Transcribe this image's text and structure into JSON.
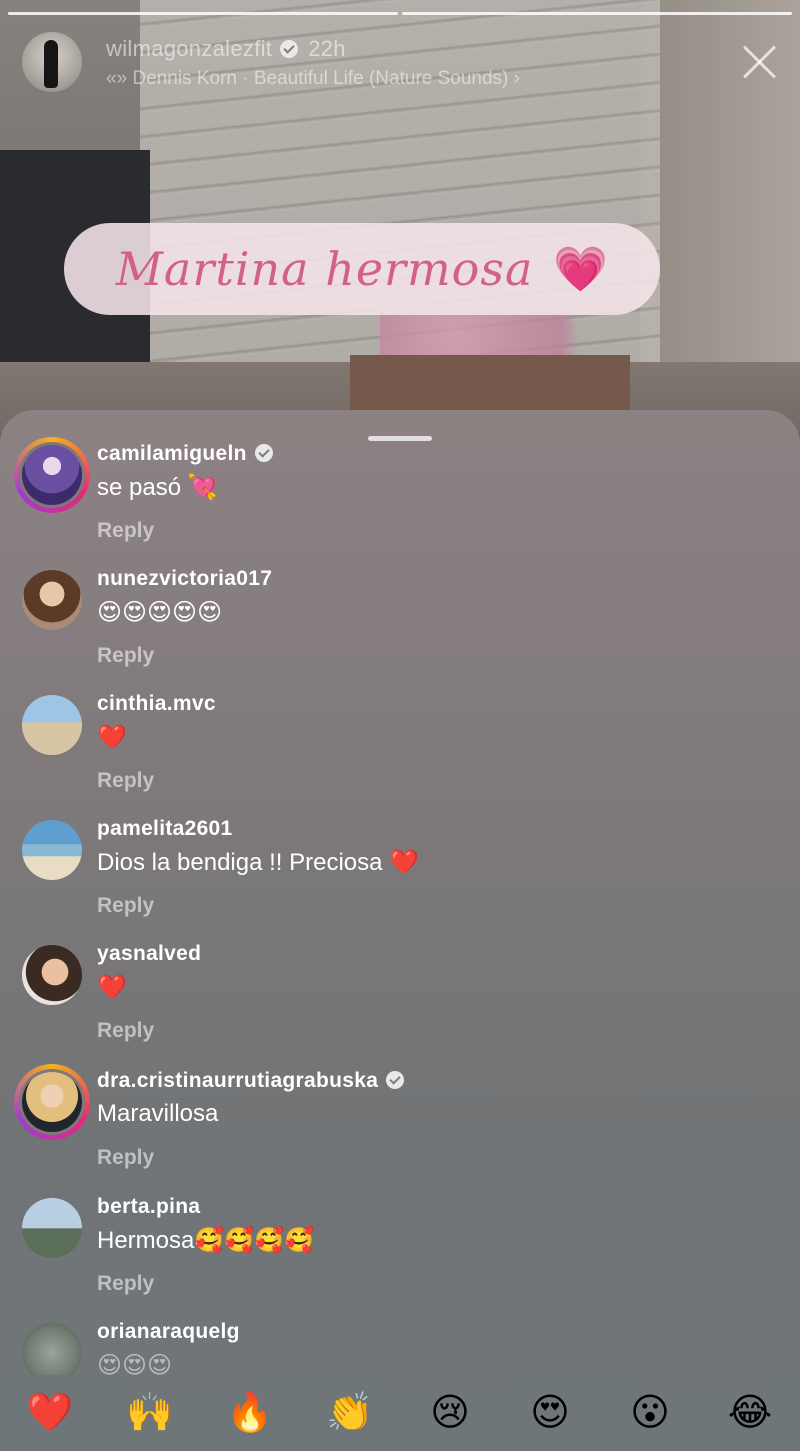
{
  "story": {
    "username": "wilmagonzalezfit",
    "time": "22h",
    "music": "«» Dennis Korn · Beautiful Life (Nature Sounds) ›",
    "sticker_text": "Martina hermosa",
    "sticker_emoji": "💗"
  },
  "comments": [
    {
      "username": "camilamigueln",
      "verified": true,
      "text": "se pasó 💘",
      "reply": "Reply"
    },
    {
      "username": "nunezvictoria017",
      "verified": false,
      "text": "😍😍😍😍😍",
      "reply": "Reply"
    },
    {
      "username": "cinthia.mvc",
      "verified": false,
      "text": "❤️",
      "reply": "Reply"
    },
    {
      "username": "pamelita2601",
      "verified": false,
      "text": "Dios la bendiga !! Preciosa ❤️",
      "reply": "Reply"
    },
    {
      "username": "yasnalved",
      "verified": false,
      "text": "❤️",
      "reply": "Reply"
    },
    {
      "username": "dra.cristinaurrutiagrabuska",
      "verified": true,
      "text": "Maravillosa",
      "reply": "Reply"
    },
    {
      "username": "berta.pina",
      "verified": false,
      "text": "Hermosa🥰🥰🥰🥰",
      "reply": "Reply"
    },
    {
      "username": "orianaraquelg",
      "verified": false,
      "text": "😍😍😍",
      "reply": ""
    }
  ],
  "reactions": [
    "❤️",
    "🙌",
    "🔥",
    "👏",
    "😢",
    "😍",
    "😮",
    "😂"
  ],
  "colors": {
    "accent_heart": "#e02227",
    "sticker_text": "#d35f8c"
  }
}
